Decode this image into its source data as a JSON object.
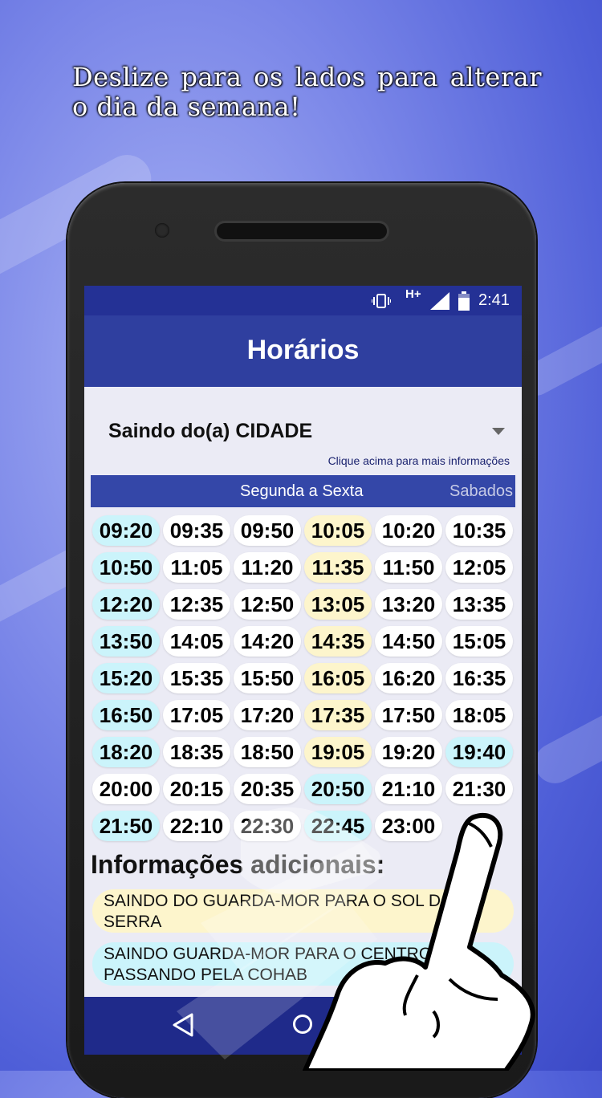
{
  "promo": {
    "headline": "Deslize para os lados para alterar o dia da semana!"
  },
  "status_bar": {
    "network": "H+",
    "time": "2:41",
    "vibrate_icon": "vibrate-icon",
    "signal_icon": "signal-icon",
    "battery_icon": "battery-icon"
  },
  "app_bar": {
    "title": "Horários"
  },
  "route": {
    "selected": "Saindo do(a) CIDADE",
    "hint": "Clique acima para mais informações"
  },
  "tabs": [
    {
      "label": "Segunda a Sexta",
      "selected": true
    },
    {
      "label": "Sabados",
      "selected": false
    }
  ],
  "times": [
    {
      "t": "09:20",
      "c": "cyan"
    },
    {
      "t": "09:35",
      "c": "white"
    },
    {
      "t": "09:50",
      "c": "white"
    },
    {
      "t": "10:05",
      "c": "yellow"
    },
    {
      "t": "10:20",
      "c": "white"
    },
    {
      "t": "10:35",
      "c": "white"
    },
    {
      "t": "10:50",
      "c": "cyan"
    },
    {
      "t": "11:05",
      "c": "white"
    },
    {
      "t": "11:20",
      "c": "white"
    },
    {
      "t": "11:35",
      "c": "yellow"
    },
    {
      "t": "11:50",
      "c": "white"
    },
    {
      "t": "12:05",
      "c": "white"
    },
    {
      "t": "12:20",
      "c": "cyan"
    },
    {
      "t": "12:35",
      "c": "white"
    },
    {
      "t": "12:50",
      "c": "white"
    },
    {
      "t": "13:05",
      "c": "yellow"
    },
    {
      "t": "13:20",
      "c": "white"
    },
    {
      "t": "13:35",
      "c": "white"
    },
    {
      "t": "13:50",
      "c": "cyan"
    },
    {
      "t": "14:05",
      "c": "white"
    },
    {
      "t": "14:20",
      "c": "white"
    },
    {
      "t": "14:35",
      "c": "yellow"
    },
    {
      "t": "14:50",
      "c": "white"
    },
    {
      "t": "15:05",
      "c": "white"
    },
    {
      "t": "15:20",
      "c": "cyan"
    },
    {
      "t": "15:35",
      "c": "white"
    },
    {
      "t": "15:50",
      "c": "white"
    },
    {
      "t": "16:05",
      "c": "yellow"
    },
    {
      "t": "16:20",
      "c": "white"
    },
    {
      "t": "16:35",
      "c": "white"
    },
    {
      "t": "16:50",
      "c": "cyan"
    },
    {
      "t": "17:05",
      "c": "white"
    },
    {
      "t": "17:20",
      "c": "white"
    },
    {
      "t": "17:35",
      "c": "yellow"
    },
    {
      "t": "17:50",
      "c": "white"
    },
    {
      "t": "18:05",
      "c": "white"
    },
    {
      "t": "18:20",
      "c": "cyan"
    },
    {
      "t": "18:35",
      "c": "white"
    },
    {
      "t": "18:50",
      "c": "white"
    },
    {
      "t": "19:05",
      "c": "yellow"
    },
    {
      "t": "19:20",
      "c": "white"
    },
    {
      "t": "19:40",
      "c": "cyan"
    },
    {
      "t": "20:00",
      "c": "white"
    },
    {
      "t": "20:15",
      "c": "white"
    },
    {
      "t": "20:35",
      "c": "white"
    },
    {
      "t": "20:50",
      "c": "cyan"
    },
    {
      "t": "21:10",
      "c": "white"
    },
    {
      "t": "21:30",
      "c": "white"
    },
    {
      "t": "21:50",
      "c": "cyan"
    },
    {
      "t": "22:10",
      "c": "white"
    },
    {
      "t": "22:30",
      "c": "white"
    },
    {
      "t": "22:45",
      "c": "cyan"
    },
    {
      "t": "23:00",
      "c": "white"
    }
  ],
  "info": {
    "title": "Informações adicionais:",
    "items": [
      {
        "text": "SAINDO DO GUARDA-MOR PARA O SOL DA SERRA",
        "color": "#fdf5cc"
      },
      {
        "text": "SAINDO GUARDA-MOR PARA O CENTRO E PASSANDO PELA COHAB",
        "color": "#cbf4fb"
      }
    ]
  },
  "colors": {
    "status_bar": "#243195",
    "app_bar": "#2f3f9f",
    "tabs": "#3447a8",
    "highlight_cyan": "#cbf4fb",
    "highlight_yellow": "#fdf5cc"
  },
  "nav": {
    "back_icon": "back-icon",
    "home_icon": "home-icon",
    "recent_icon": "recent-apps-icon"
  }
}
